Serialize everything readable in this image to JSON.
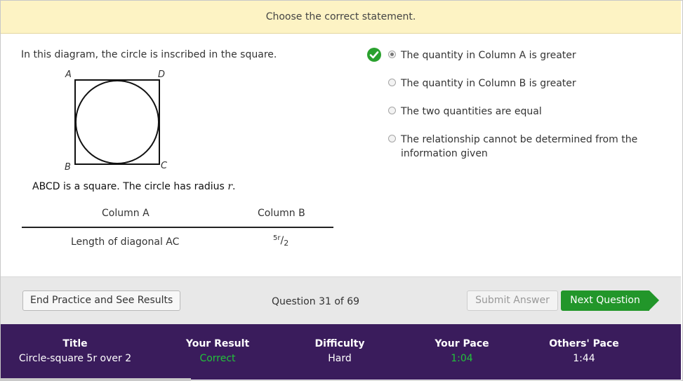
{
  "banner": {
    "instruction": "Choose the correct statement."
  },
  "question": {
    "prompt": "In this diagram, the circle is inscribed in the square.",
    "diagram": {
      "labels": {
        "a": "A",
        "b": "B",
        "c": "C",
        "d": "D"
      }
    },
    "statement_prefix": "ABCD is a square.  The circle has radius ",
    "statement_var": "r",
    "statement_suffix": ".",
    "columns": {
      "a_header": "Column A",
      "b_header": "Column B",
      "a_value": "Length of diagonal AC",
      "b_value": {
        "numerator": "5r",
        "slash": "/",
        "denominator": "2"
      }
    }
  },
  "answers": {
    "selected_index": 0,
    "correct_index": 0,
    "options": [
      {
        "label": "The quantity in Column A is greater"
      },
      {
        "label": "The quantity in Column B is greater"
      },
      {
        "label": "The two quantities are equal"
      },
      {
        "label": "The relationship cannot be determined from the information given"
      }
    ]
  },
  "navigation": {
    "end_label": "End Practice and See Results",
    "question_counter": "Question 31 of 69",
    "submit_label": "Submit Answer",
    "next_label": "Next Question"
  },
  "footer": {
    "title": {
      "label": "Title",
      "value": "Circle-square 5r over 2"
    },
    "result": {
      "label": "Your Result",
      "value": "Correct"
    },
    "difficulty": {
      "label": "Difficulty",
      "value": "Hard"
    },
    "your_pace": {
      "label": "Your Pace",
      "value": "1:04"
    },
    "others_pace": {
      "label": "Others' Pace",
      "value": "1:44"
    }
  },
  "colors": {
    "banner_bg": "#fdf3c4",
    "correct_green": "#2aa12e",
    "next_button": "#22962a",
    "footer_bg": "#3a1c5c",
    "footer_highlight": "#22c23a"
  },
  "icons": {
    "correct": "checkmark-circle-icon",
    "next": "arrow-right-icon"
  }
}
